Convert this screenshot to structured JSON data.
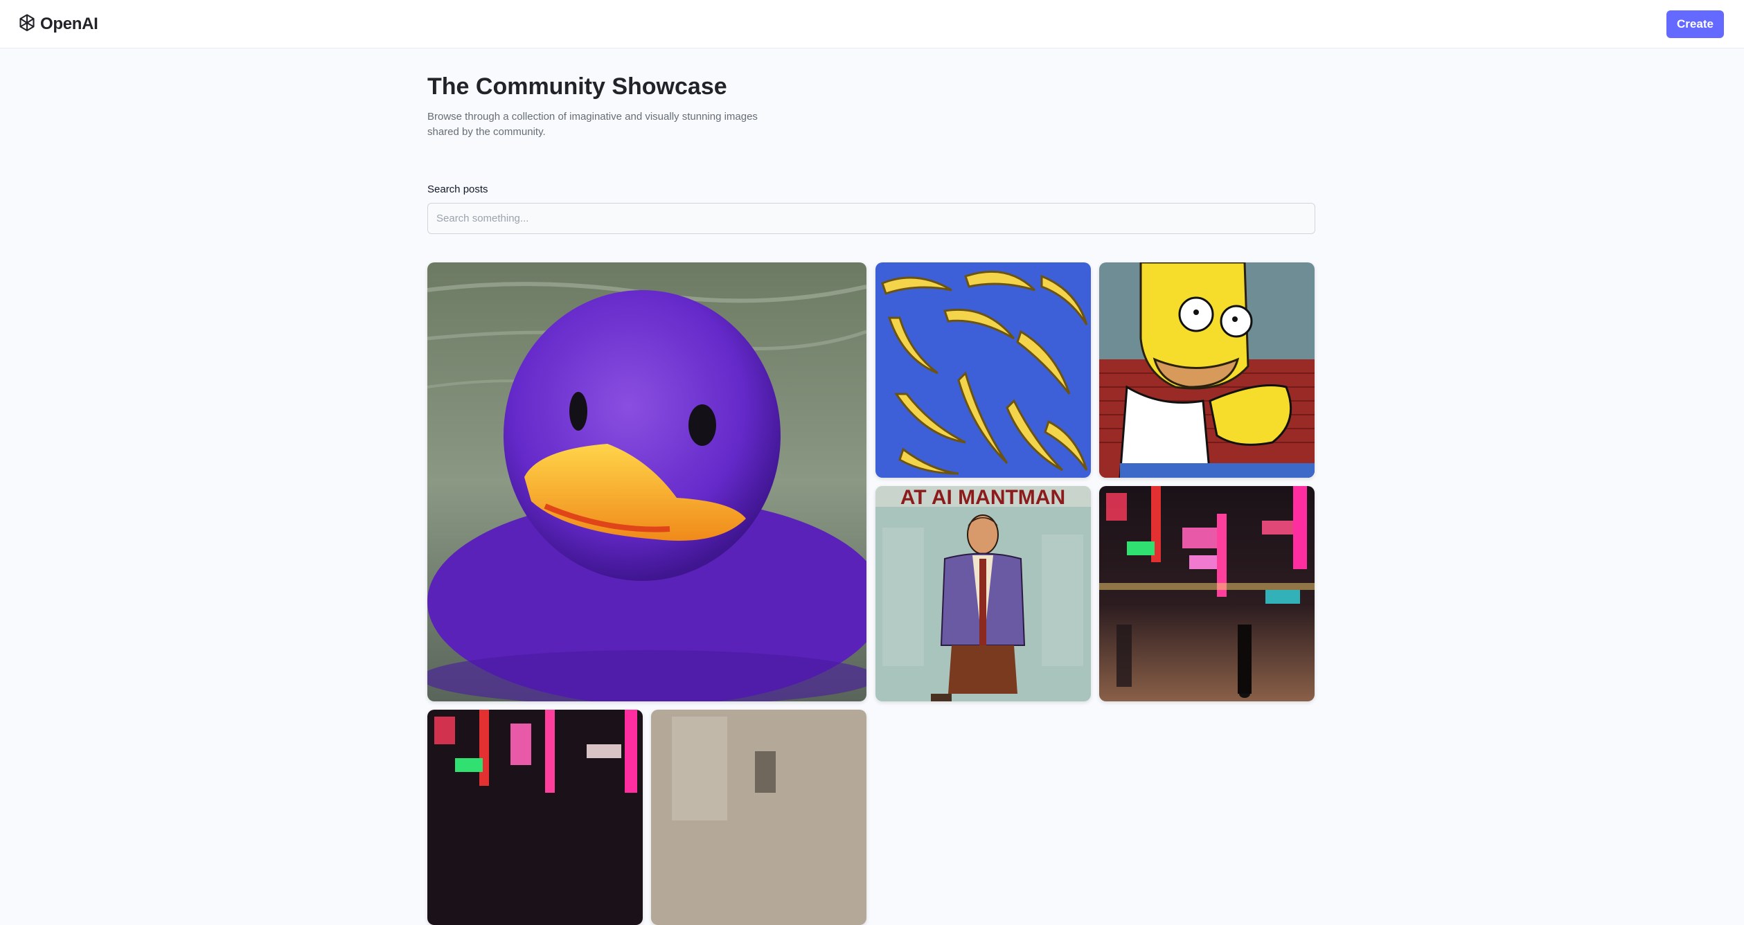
{
  "header": {
    "brand": "OpenAI",
    "create_label": "Create"
  },
  "hero": {
    "title": "The Community Showcase",
    "subtitle": "Browse through a collection of imaginative and visually stunning images shared by the community."
  },
  "search": {
    "label": "Search posts",
    "placeholder": "Search something...",
    "value": ""
  },
  "gallery": {
    "items": [
      {
        "subject": "purple rubber duck on water"
      },
      {
        "subject": "bananas on blue background"
      },
      {
        "subject": "cartoon character eating banana"
      },
      {
        "subject": "cartoon man standing",
        "caption_in_image": "AT AI MANTMAN"
      },
      {
        "subject": "neon city street at night"
      },
      {
        "subject": "neon city street at night"
      },
      {
        "subject": "beige blurred scene"
      }
    ]
  },
  "colors": {
    "accent": "#6469ff",
    "background": "#f9fafe",
    "title": "#222328",
    "subtitle": "#666e75"
  }
}
